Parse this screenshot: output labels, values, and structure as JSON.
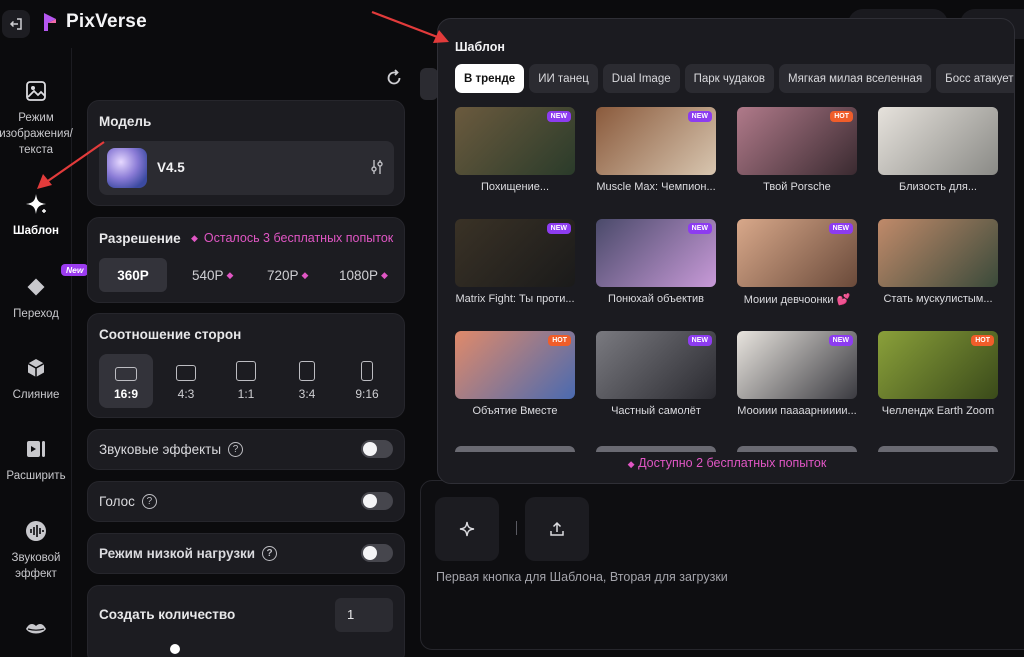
{
  "app": {
    "name": "PixVerse"
  },
  "sidebar": {
    "items": [
      {
        "label": "Режим\nизображения/\nтекста",
        "icon": "image-icon"
      },
      {
        "label": "Шаблон",
        "icon": "sparkle-icon",
        "active": true
      },
      {
        "label": "Переход",
        "icon": "transition-icon",
        "badge": "New"
      },
      {
        "label": "Слияние",
        "icon": "cube-icon"
      },
      {
        "label": "Расширить",
        "icon": "extend-icon"
      },
      {
        "label": "Звуковой\nэффект",
        "icon": "sound-icon"
      },
      {
        "label": "",
        "icon": "lips-icon"
      }
    ]
  },
  "settings": {
    "model": {
      "title": "Модель",
      "name": "V4.5"
    },
    "resolution": {
      "title": "Разрешение",
      "free_notice": "Осталось 3 бесплатных попыток",
      "options": [
        "360P",
        "540P",
        "720P",
        "1080P"
      ],
      "selected": "360P"
    },
    "aspect": {
      "title": "Соотношение сторон",
      "options": [
        "16:9",
        "4:3",
        "1:1",
        "3:4",
        "9:16"
      ],
      "selected": "16:9"
    },
    "sound_effects": {
      "label": "Звуковые эффекты",
      "on": false
    },
    "voice": {
      "label": "Голос",
      "on": false
    },
    "low_load": {
      "label": "Режим низкой нагрузки",
      "on": false
    },
    "count": {
      "label": "Создать количество",
      "value": "1"
    }
  },
  "prompt": {
    "hint": "Первая кнопка для Шаблона, Вторая для загрузки"
  },
  "template_popup": {
    "title": "Шаблон",
    "tabs": [
      "В тренде",
      "ИИ танец",
      "Dual Image",
      "Парк чудаков",
      "Мягкая милая вселенная",
      "Босс атакует"
    ],
    "active_tab": "В тренде",
    "cards": [
      {
        "label": "Похищение...",
        "badge": "NEW",
        "c1": "#6b5a3e",
        "c2": "#2a3b2a"
      },
      {
        "label": "Muscle Max: Чемпион...",
        "badge": "NEW",
        "c1": "#8a5a3c",
        "c2": "#d8c6b0"
      },
      {
        "label": "Твой Porsche",
        "badge": "HOT",
        "c1": "#b07a8a",
        "c2": "#3a2a30"
      },
      {
        "label": "Близость для...",
        "badge": "",
        "c1": "#e6e2dc",
        "c2": "#8a8a86"
      },
      {
        "label": "Matrix Fight: Ты проти...",
        "badge": "NEW",
        "c1": "#3a3226",
        "c2": "#1a1a1a"
      },
      {
        "label": "Понюхай объектив",
        "badge": "NEW",
        "c1": "#4a4a6a",
        "c2": "#c89ad8"
      },
      {
        "label": "Моиии девчоонки 💕",
        "badge": "NEW",
        "c1": "#d8a88a",
        "c2": "#6a4a3a"
      },
      {
        "label": "Стать мускулистым...",
        "badge": "",
        "c1": "#c08a6a",
        "c2": "#3a4a3a"
      },
      {
        "label": "Объятие Вместе",
        "badge": "HOT",
        "c1": "#e08a6a",
        "c2": "#4a6ab0"
      },
      {
        "label": "Частный самолёт",
        "badge": "NEW",
        "c1": "#7a7a80",
        "c2": "#2a2a30"
      },
      {
        "label": "Мооиии паааарнииии...",
        "badge": "NEW",
        "c1": "#e8e4de",
        "c2": "#3a3a40"
      },
      {
        "label": "Челлендж Earth Zoom",
        "badge": "HOT",
        "c1": "#8aa03a",
        "c2": "#3a4a1a"
      }
    ],
    "footer": "Доступно 2 бесплатных попыток"
  }
}
